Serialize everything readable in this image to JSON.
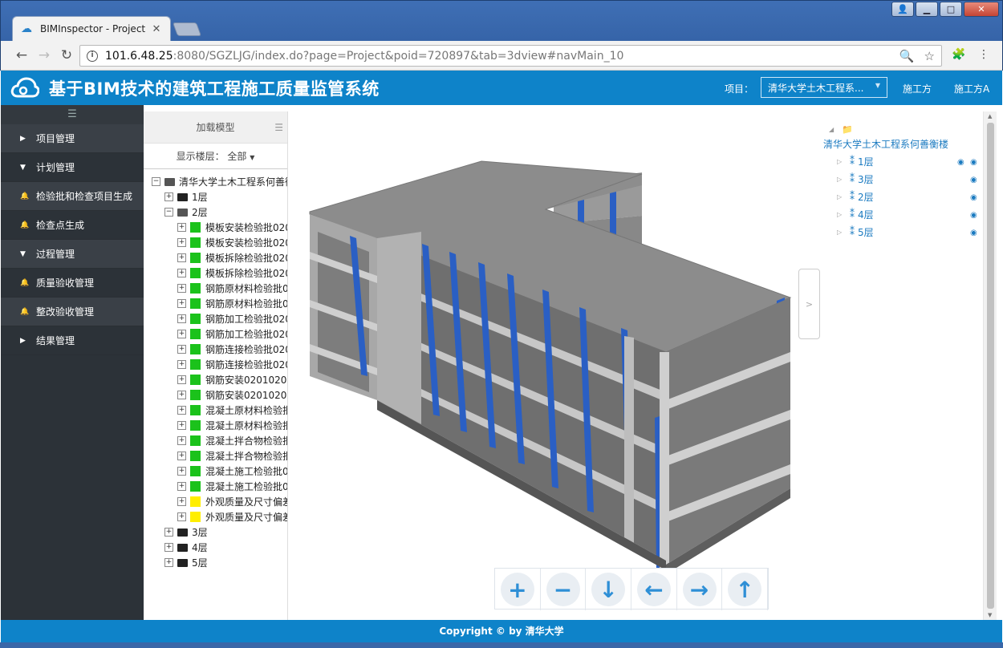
{
  "browser": {
    "tab_title": "BIMInspector - Project",
    "url_host": "101.6.48.25",
    "url_rest": ":8080/SGZLJG/index.do?page=Project&poid=720897&tab=3dview#navMain_10"
  },
  "header": {
    "title": "基于BIM技术的建筑工程施工质量监管系统",
    "project_label": "项目：",
    "project_selected": "清华大学土木工程系...",
    "org": "施工方",
    "user": "施工方A"
  },
  "sidebar": {
    "items": [
      {
        "label": "项目管理",
        "icon": "caret-right-icon",
        "glyph": "▶"
      },
      {
        "label": "计划管理",
        "icon": "caret-down-icon",
        "glyph": "▼"
      },
      {
        "label": "检验批和检查项目生成",
        "icon": "bell-icon",
        "glyph": "🔔"
      },
      {
        "label": "检查点生成",
        "icon": "bell-icon",
        "glyph": "🔔"
      },
      {
        "label": "过程管理",
        "icon": "caret-down-icon",
        "glyph": "▼"
      },
      {
        "label": "质量验收管理",
        "icon": "bell-icon",
        "glyph": "🔔"
      },
      {
        "label": "整改验收管理",
        "icon": "bell-icon",
        "glyph": "🔔"
      },
      {
        "label": "结果管理",
        "icon": "caret-right-icon",
        "glyph": "▶"
      }
    ]
  },
  "tree": {
    "load_model": "加载模型",
    "floor_filter_label": "显示楼层：",
    "floor_filter_value": "全部",
    "root": "清华大学土木工程系何善衡",
    "floors_before": [
      "1层"
    ],
    "open_floor": "2层",
    "batches": [
      {
        "label": "模板安装检验批020",
        "status": "green"
      },
      {
        "label": "模板安装检验批020",
        "status": "green"
      },
      {
        "label": "模板拆除检验批020",
        "status": "green"
      },
      {
        "label": "模板拆除检验批020",
        "status": "green"
      },
      {
        "label": "钢筋原材料检验批0",
        "status": "green"
      },
      {
        "label": "钢筋原材料检验批0",
        "status": "green"
      },
      {
        "label": "钢筋加工检验批020",
        "status": "green"
      },
      {
        "label": "钢筋加工检验批020",
        "status": "green"
      },
      {
        "label": "钢筋连接检验批020",
        "status": "green"
      },
      {
        "label": "钢筋连接检验批020",
        "status": "green"
      },
      {
        "label": "钢筋安装02010204",
        "status": "green"
      },
      {
        "label": "钢筋安装02010204",
        "status": "green"
      },
      {
        "label": "混凝土原材料检验批",
        "status": "green"
      },
      {
        "label": "混凝土原材料检验批",
        "status": "green"
      },
      {
        "label": "混凝土拌合物检验批",
        "status": "green"
      },
      {
        "label": "混凝土拌合物检验批",
        "status": "green"
      },
      {
        "label": "混凝土施工检验批0",
        "status": "green"
      },
      {
        "label": "混凝土施工检验批0",
        "status": "green"
      },
      {
        "label": "外观质量及尺寸偏差",
        "status": "yellow"
      },
      {
        "label": "外观质量及尺寸偏差",
        "status": "yellow"
      }
    ],
    "floors_after": [
      "3层",
      "4层",
      "5层"
    ]
  },
  "layers": {
    "root": "清华大学土木工程系何善衡楼",
    "items": [
      {
        "label": "1层",
        "eyes": 2
      },
      {
        "label": "3层",
        "eyes": 1
      },
      {
        "label": "2层",
        "eyes": 1
      },
      {
        "label": "4层",
        "eyes": 1
      },
      {
        "label": "5层",
        "eyes": 1
      }
    ]
  },
  "nav_controls": [
    {
      "name": "zoom-in-button",
      "glyph": "+"
    },
    {
      "name": "zoom-out-button",
      "glyph": "−"
    },
    {
      "name": "move-down-button",
      "glyph": "↓"
    },
    {
      "name": "move-left-button",
      "glyph": "←"
    },
    {
      "name": "move-right-button",
      "glyph": "→"
    },
    {
      "name": "move-up-button",
      "glyph": "↑"
    }
  ],
  "collapse_glyph": ">",
  "footer": "Copyright © by 清华大学",
  "colors": {
    "brand": "#0e83c9",
    "sidebar": "#2c3238",
    "complete": "#1bc21b",
    "pending": "#ffee00",
    "column": "#2a5fc4"
  }
}
